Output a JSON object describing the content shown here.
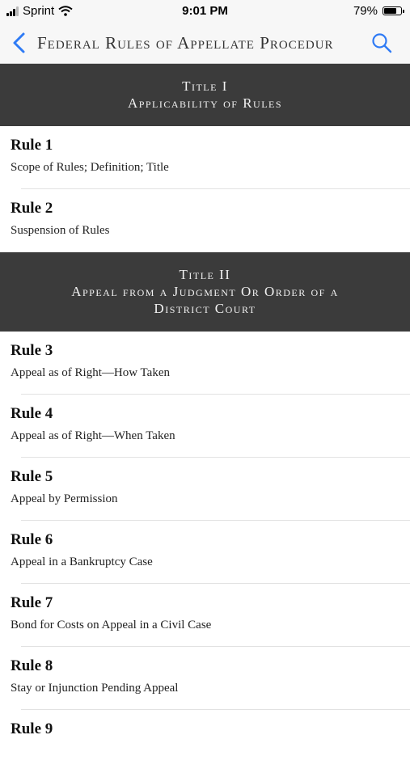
{
  "status": {
    "carrier": "Sprint",
    "time": "9:01 PM",
    "battery_text": "79%",
    "battery_level": 0.79
  },
  "nav": {
    "title": "Federal Rules of Appellate Procedur"
  },
  "titles": [
    {
      "line1": "Title I",
      "line2": "Applicability of Rules",
      "line3": ""
    },
    {
      "line1": "Title II",
      "line2": "Appeal from a Judgment Or Order of a",
      "line3": "District Court"
    }
  ],
  "rules": [
    {
      "num": "Rule 1",
      "desc": "Scope of Rules; Definition; Title"
    },
    {
      "num": "Rule 2",
      "desc": "Suspension of Rules"
    },
    {
      "num": "Rule 3",
      "desc": "Appeal as of Right—How Taken"
    },
    {
      "num": "Rule 4",
      "desc": "Appeal as of Right—When Taken"
    },
    {
      "num": "Rule 5",
      "desc": "Appeal by Permission"
    },
    {
      "num": "Rule 6",
      "desc": "Appeal in a Bankruptcy Case"
    },
    {
      "num": "Rule 7",
      "desc": "Bond for Costs on Appeal in a Civil Case"
    },
    {
      "num": "Rule 8",
      "desc": "Stay or Injunction Pending Appeal"
    },
    {
      "num": "Rule 9",
      "desc": ""
    }
  ]
}
